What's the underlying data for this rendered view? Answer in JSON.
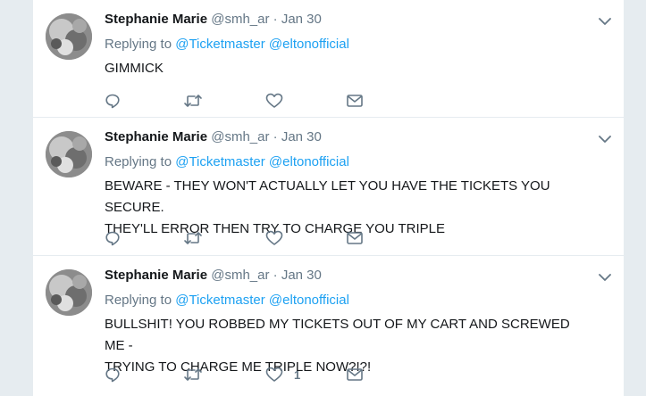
{
  "tweets": [
    {
      "name": "Stephanie Marie",
      "handle": "@smh_ar",
      "separator": "·",
      "date": "Jan 30",
      "replying_prefix": "Replying to",
      "mentions": [
        "@Ticketmaster",
        "@eltonofficial"
      ],
      "text_lines": [
        "GIMMICK"
      ],
      "like_count": ""
    },
    {
      "name": "Stephanie Marie",
      "handle": "@smh_ar",
      "separator": "·",
      "date": "Jan 30",
      "replying_prefix": "Replying to",
      "mentions": [
        "@Ticketmaster",
        "@eltonofficial"
      ],
      "text_lines": [
        "BEWARE - THEY WON'T ACTUALLY LET YOU HAVE THE TICKETS YOU SECURE.",
        "THEY'LL ERROR THEN TRY TO CHARGE YOU TRIPLE"
      ],
      "like_count": ""
    },
    {
      "name": "Stephanie Marie",
      "handle": "@smh_ar",
      "separator": "·",
      "date": "Jan 30",
      "replying_prefix": "Replying to",
      "mentions": [
        "@Ticketmaster",
        "@eltonofficial"
      ],
      "text_lines": [
        "BULLSHIT! YOU ROBBED MY TICKETS OUT OF MY CART AND SCREWED ME -",
        "TRYING TO CHARGE ME TRIPLE NOW?!?!"
      ],
      "like_count": "1"
    }
  ],
  "icons": {
    "caret": "chevron-down-icon",
    "reply": "reply-icon",
    "retweet": "retweet-icon",
    "like": "heart-icon",
    "dm": "envelope-icon"
  },
  "colors": {
    "link": "#1da1f2",
    "secondary_text": "#657786",
    "background": "#e6ecf0"
  }
}
